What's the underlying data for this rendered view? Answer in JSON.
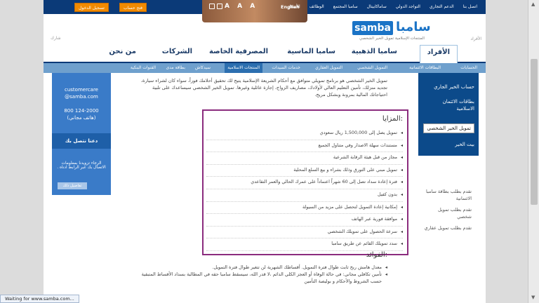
{
  "topbar": {
    "links": [
      "اتصل بنا",
      "الدعم التجاري",
      "التواجد الدولي",
      "ساماكابيتال",
      "سامبا المجتمع",
      "الوظائف",
      "الأسعار"
    ],
    "english": "English",
    "font_sizes": "A A A",
    "open_account": "فتح حساب",
    "login": "تسجيل الدخول"
  },
  "header": {
    "logo_en": "samba",
    "logo_ar": "سامبا",
    "tagline": "المنتجات الإسلامية  تمويل الخير الشخصي",
    "afrad_small": "الأفراد",
    "share": "شارك"
  },
  "mainnav": {
    "tabs": [
      "الأفراد",
      "سامبا الذهبية",
      "سامبا الماسية",
      "المصرفية الخاصة",
      "الشركات",
      "من نحن"
    ]
  },
  "subnav": {
    "items": [
      "الحسابات",
      "البطاقات الائتمانية",
      "التمويل الشخصي",
      "التمويل العقاري",
      "خدمات السيدات",
      "المنتجات الاسلامية",
      "سيدكاش",
      "بطاقة مدى",
      "القنوات البنكية"
    ]
  },
  "right_sidebar": {
    "items": [
      "حساب الخير الجاري",
      "بطاقات الائتمان الاسلامية",
      "تمويل الخير الشخصي",
      "بيت الخير"
    ]
  },
  "right_links": [
    "تقدم بطلب بطاقة سامبا الائتمانية",
    "تقدم بطلب تمويل شخصي",
    "تقدم بطلب تمويل عقاري"
  ],
  "left_sidebar": {
    "email1": "customercare",
    "email2": "@samba.com",
    "phone": "800 124-2000",
    "phone_note": "(هاتف مجاني)",
    "contact_header": "دعنا نتصل بك",
    "contact_text": "الرجاء تزويدنا بمعلومات الاتصال بك عبر الرابط ادناه .",
    "contact_button": "تفاصيل ذلك"
  },
  "content": {
    "intro": "تمويل الخير الشخصي هو برنامج تمويلي متوافق مع أحكام الشريعة الإسلامية يتيح لك تحقيق أحلامك فوراً، سواء كان لشراء سيارة، تجديد منزلك، تأمين التعليم العالي لأولادك، مصاريف الزواج، إجازة عائلية وغيرها. تمويل الخير الشخصي سيساعدك على تلبية احتياجاتك المالية بمرونة وبشكل مريح.",
    "advantages_title": "المزايا:",
    "advantages": [
      "تمويل يصل إلى 1,500,000 ريال سعودي",
      "مستندات سهلة الاصدار وفي متناول الجميع",
      "مجاز من قبل هيئة الرقابة الشرعية",
      "تمويل مبني على التورق وذلك بشراء و بيع السلع المحلية",
      "فترة إعادة سداد تصل إلى 60 شهراً اعتماداً على عمرك الحالي والعمر التقاعدي",
      "بدون كفيل",
      "إمكانية إعادة التمويل لتحصل على مزيد من السيولة",
      "موافقة فورية عبر الهاتف",
      "سرعة الحصول على تمويلك الشخصي",
      "سدد تمويلك القائم عن طريق سامبا"
    ],
    "usage_title": "الفوائد:",
    "usage": [
      "معدل هامش ربح ثابت طوال فترة التمويل. أقساطك الشهرية لن تتغير طوال فترة التمويل.",
      "تأمين تكافلي مجاني: في حالة الوفاة أو العجز الكلي الدائم ،لا قدر الله، سيسقط سامبا حقه في المطالبة بسداد الأقساط المتبقية حسب الشروط والأحكام و بوليصة التأمين"
    ]
  },
  "status_text": "Waiting for www.samba.com..."
}
